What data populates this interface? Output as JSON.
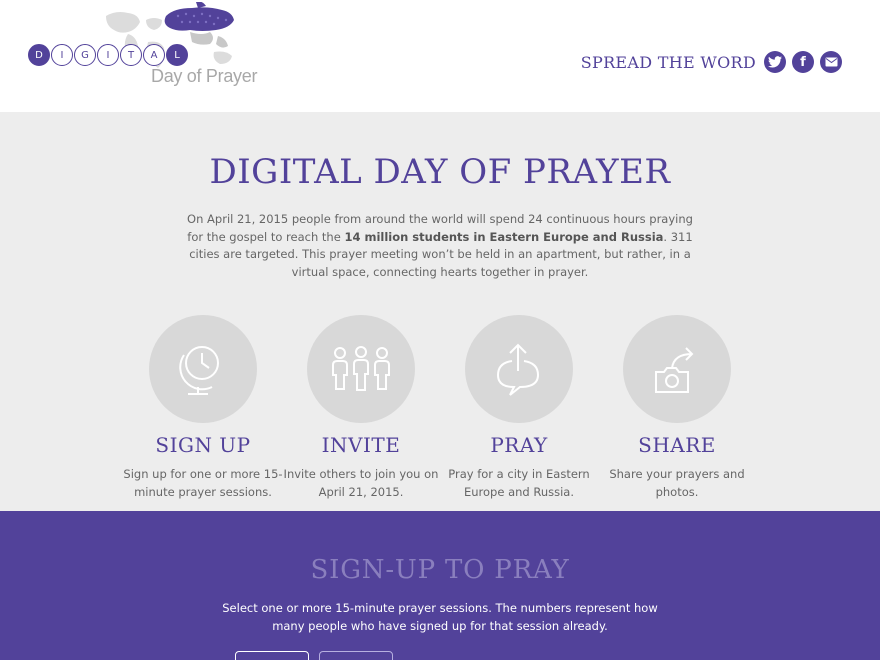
{
  "header": {
    "logo_letters": [
      "D",
      "I",
      "G",
      "I",
      "T",
      "A",
      "L"
    ],
    "logo_subtitle": "Day of Prayer",
    "spread_label": "SPREAD THE WORD",
    "social_icons": [
      "twitter-icon",
      "facebook-icon",
      "email-icon"
    ],
    "social_letters": {
      "facebook": "f"
    }
  },
  "intro": {
    "title": "DIGITAL DAY OF PRAYER",
    "text_before": "On April 21, 2015 people from around the world will spend 24 continuous hours praying for the gospel to reach the ",
    "text_bold": "14 million students in Eastern Europe and Russia",
    "text_after": ". 311 cities are targeted. This prayer meeting won’t be held in an apartment, but rather, in a virtual space, connecting hearts together in prayer."
  },
  "steps": [
    {
      "icon": "globe-clock-icon",
      "title": "SIGN UP",
      "desc": "Sign up for one or more 15-minute prayer sessions."
    },
    {
      "icon": "people-icon",
      "title": "INVITE",
      "desc": "Invite others to join you on April 21, 2015."
    },
    {
      "icon": "pray-bubble-icon",
      "title": "PRAY",
      "desc": "Pray for a city in Eastern Europe and Russia."
    },
    {
      "icon": "camera-share-icon",
      "title": "SHARE",
      "desc": "Share your prayers and photos."
    }
  ],
  "signup": {
    "title": "SIGN-UP TO PRAY",
    "text": "Select one or more 15-minute prayer sessions. The numbers represent how many people who have signed up for that session already."
  },
  "colors": {
    "accent": "#52429a",
    "band_title": "#8a7fbe",
    "light_bg": "#ededed",
    "circle": "#d8d8d8"
  }
}
